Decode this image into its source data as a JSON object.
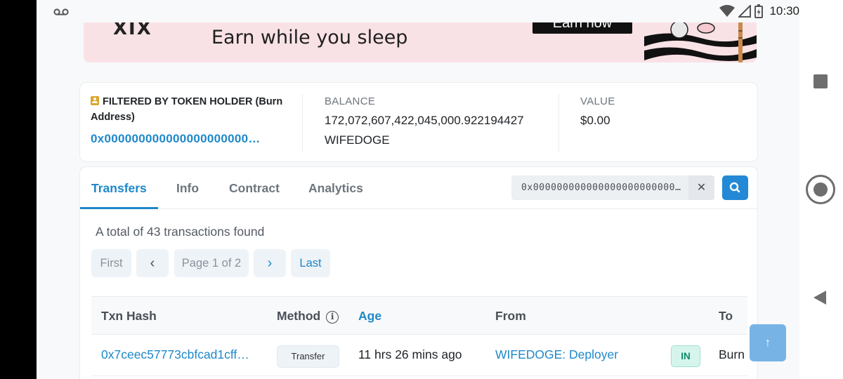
{
  "status_bar": {
    "time": "10:30",
    "left_icon": "voicemail-icon",
    "right_icons": [
      "wifi-icon",
      "signal-icon",
      "battery-charging-icon"
    ]
  },
  "banner": {
    "logo_text": "XIX",
    "tagline": "Earn while you sleep",
    "button_label": "Earn now"
  },
  "summary": {
    "filter_label": "FILTERED BY TOKEN HOLDER (Burn Address)",
    "filter_address": "0x000000000000000000000…",
    "balance_caption": "BALANCE",
    "balance_amount": "172,072,607,422,045,000.922194427",
    "balance_token": "WIFEDOGE",
    "value_caption": "VALUE",
    "value_amount": "$0.00"
  },
  "tabs": [
    {
      "label": "Transfers",
      "active": true
    },
    {
      "label": "Info",
      "active": false
    },
    {
      "label": "Contract",
      "active": false
    },
    {
      "label": "Analytics",
      "active": false
    }
  ],
  "search": {
    "value": "0x000000000000000000000000…"
  },
  "total_text": "A total of 43 transactions found",
  "pagination": {
    "first": "First",
    "prev": "‹",
    "page_label": "Page 1 of 2",
    "next": "›",
    "last": "Last"
  },
  "table": {
    "headers": [
      "Txn Hash",
      "Method",
      "Age",
      "From",
      "To"
    ],
    "rows": [
      {
        "txn_hash": "0x7ceec57773cbfcad1cff…",
        "method": "Transfer",
        "age": "11 hrs 26 mins ago",
        "from": "WIFEDOGE: Deployer",
        "direction": "IN",
        "to": "Burn"
      }
    ]
  },
  "colors": {
    "accent": "#1e88c9",
    "banner_bg": "#f9e2e6",
    "in_badge": "#d5f5ec"
  }
}
